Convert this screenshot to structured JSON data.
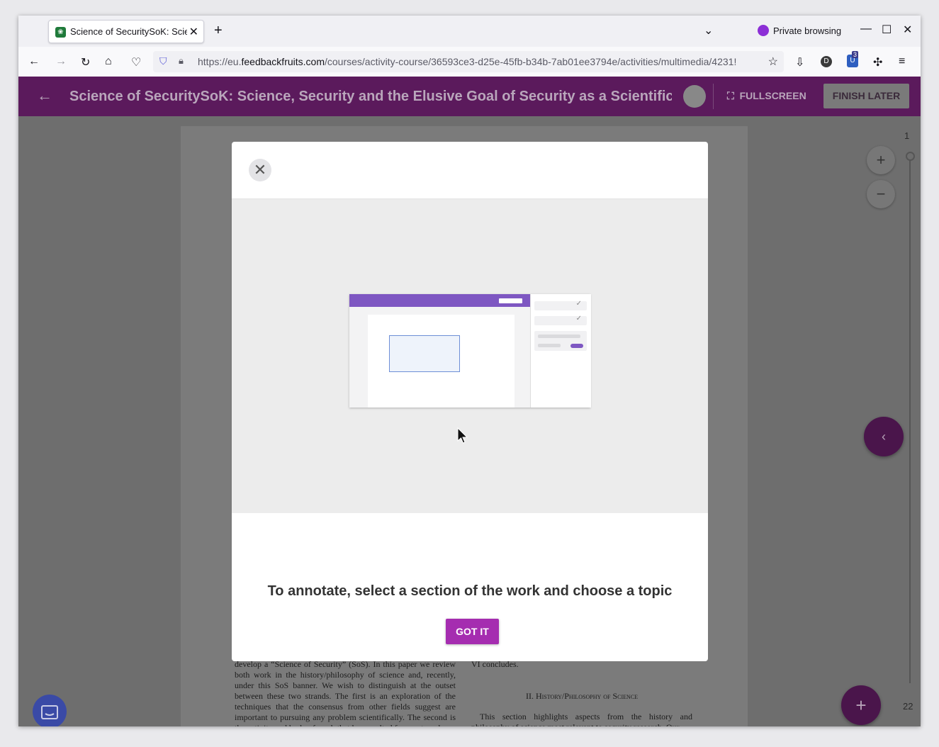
{
  "browser": {
    "tab_title": "Science of SecuritySoK: Scie",
    "tab_close": "✕",
    "new_tab": "+",
    "private_label": "Private browsing",
    "url_prefix": "https://eu.",
    "url_domain": "feedbackfruits.com",
    "url_path": "/courses/activity-course/36593ce3-d25e-45fb-b34b-7ab01ee3794e/activities/multimedia/4231!",
    "extension_badge": "3",
    "profile_initial": "D"
  },
  "app": {
    "title": "Science of SecuritySoK: Science, Security and the Elusive Goal of Security as a Scientific …",
    "fullscreen_label": "FULLSCREEN",
    "finish_label": "FINISH LATER"
  },
  "viewer": {
    "page_first": "1",
    "page_last": "22",
    "zoom_in": "+",
    "zoom_out": "−"
  },
  "document": {
    "left_col": "develop a “Science of Security” (SoS). In this paper we review both work in the history/philosophy of science and, recently, under this SoS banner. We wish to distinguish at the outset between these two strands. The first is an exploration of the techniques that the consensus from other fields suggest are important to pursuing any problem scientifically. The second is the activity and body of work that has resulted from external",
    "right_top": "VI concludes.",
    "section_heading": "II. History/Philosophy of Science",
    "right_para": "This section highlights aspects from the history and philosophy of science most relevant to security research. Our"
  },
  "modal": {
    "close": "✕",
    "message": "To annotate, select a section of the work and choose a topic",
    "button": "GOT IT"
  },
  "colors": {
    "app_header": "#5b1a5c",
    "button_purple": "#a52db0",
    "illustration_purple": "#7e57c2"
  }
}
